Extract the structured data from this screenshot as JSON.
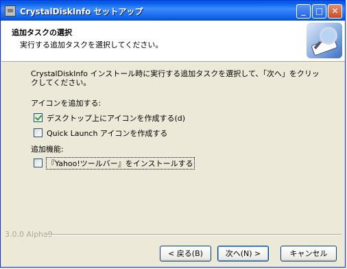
{
  "window": {
    "title": "CrystalDiskInfo セットアップ"
  },
  "header": {
    "title": "追加タスクの選択",
    "subtitle": "実行する追加タスクを選択してください。"
  },
  "intro": "CrystalDiskInfo インストール時に実行する追加タスクを選択して、「次へ」をクリックしてください。",
  "groups": [
    {
      "label": "アイコンを追加する:"
    },
    {
      "label": "追加機能:"
    }
  ],
  "tasks": [
    {
      "label": "デスクトップ上にアイコンを作成する(d)",
      "checked": true
    },
    {
      "label": "Quick Launch アイコンを作成する",
      "checked": false
    },
    {
      "label": "『Yahoo!ツールバー』をインストールする",
      "checked": false
    }
  ],
  "footer": {
    "version": "3.0.0 Alpha9"
  },
  "buttons": {
    "back": "< 戻る(B)",
    "next": "次へ(N) >",
    "cancel": "キャンセル"
  }
}
